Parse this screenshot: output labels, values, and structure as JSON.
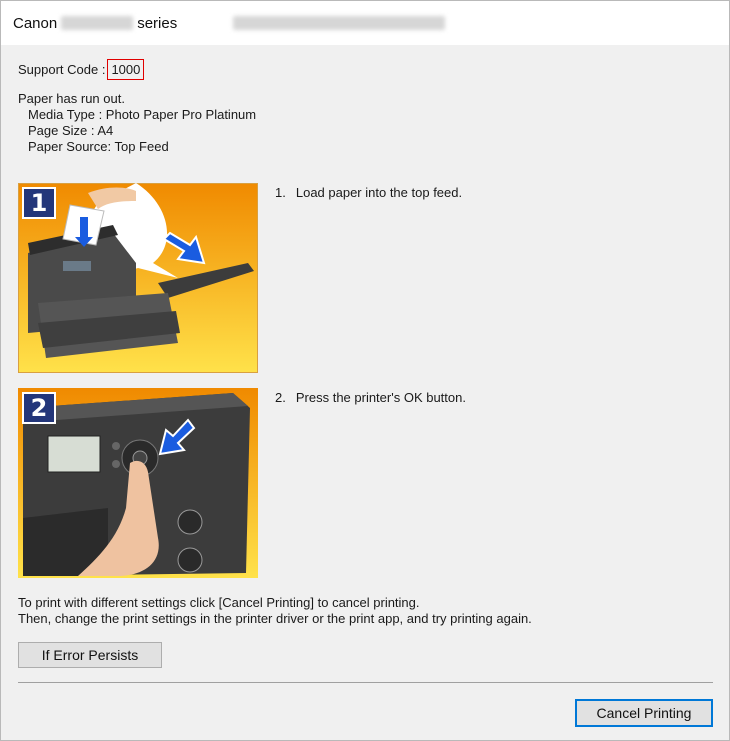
{
  "window": {
    "title_prefix": "Canon",
    "title_model": "PRO-1100",
    "title_suffix": "series",
    "title_extra": "5-2017-PRO1100.canon.net"
  },
  "support": {
    "label": "Support Code :",
    "code": "1000"
  },
  "message": {
    "headline": "Paper has run out.",
    "details": [
      "Media Type : Photo Paper Pro Platinum",
      "Page Size : A4",
      "Paper Source: Top Feed"
    ]
  },
  "steps": [
    {
      "number": "1",
      "badge": "1",
      "text": "Load paper into the top feed."
    },
    {
      "number": "2",
      "badge": "2",
      "text": "Press the printer's OK button."
    }
  ],
  "footer": {
    "line1": "To print with different settings click [Cancel Printing] to cancel printing.",
    "line2": "Then, change the print settings in the printer driver or the print app, and try printing again."
  },
  "buttons": {
    "if_error_persists": "If Error Persists",
    "cancel_printing": "Cancel Printing"
  },
  "colors": {
    "support_code_border": "#e00000",
    "badge": "#23367a",
    "focus_border": "#0078d7"
  }
}
